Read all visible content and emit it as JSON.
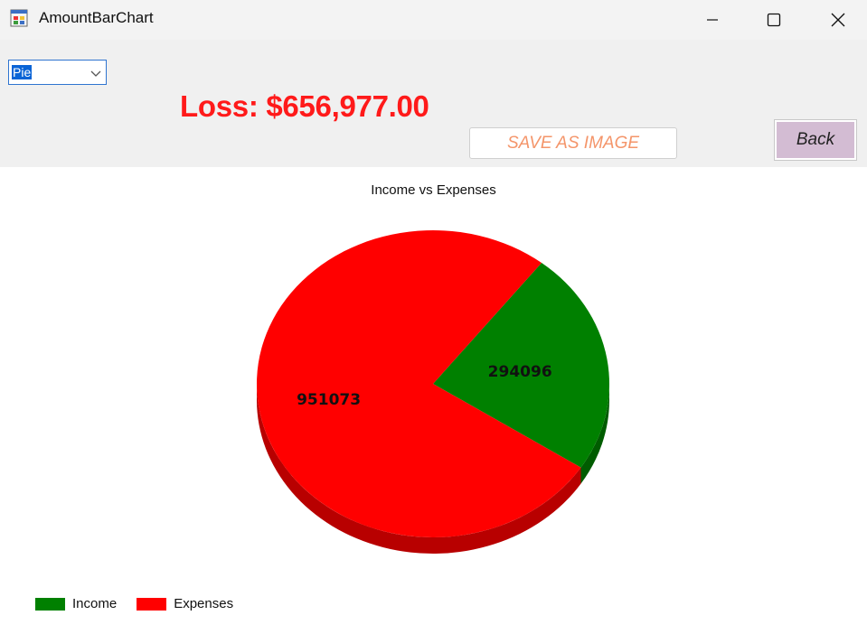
{
  "window": {
    "title": "AmountBarChart",
    "icon": "windows-form-icon"
  },
  "toolbar": {
    "chart_type_selected": "Pie",
    "loss_text": "Loss: $656,977.00",
    "save_label": "SAVE AS IMAGE",
    "back_label": "Back"
  },
  "colors": {
    "income": "#008000",
    "expenses": "#ff0000",
    "loss_text": "#ff1a1a",
    "save_text": "#f4956a",
    "back_bg": "#d3bcd3"
  },
  "chart_data": {
    "type": "pie",
    "title": "Income vs Expenses",
    "categories": [
      "Income",
      "Expenses"
    ],
    "values": [
      294096,
      951073
    ],
    "data_labels": [
      "294096",
      "951073"
    ],
    "colors": [
      "#008000",
      "#ff0000"
    ],
    "legend_position": "bottom-left",
    "style": "3d"
  }
}
